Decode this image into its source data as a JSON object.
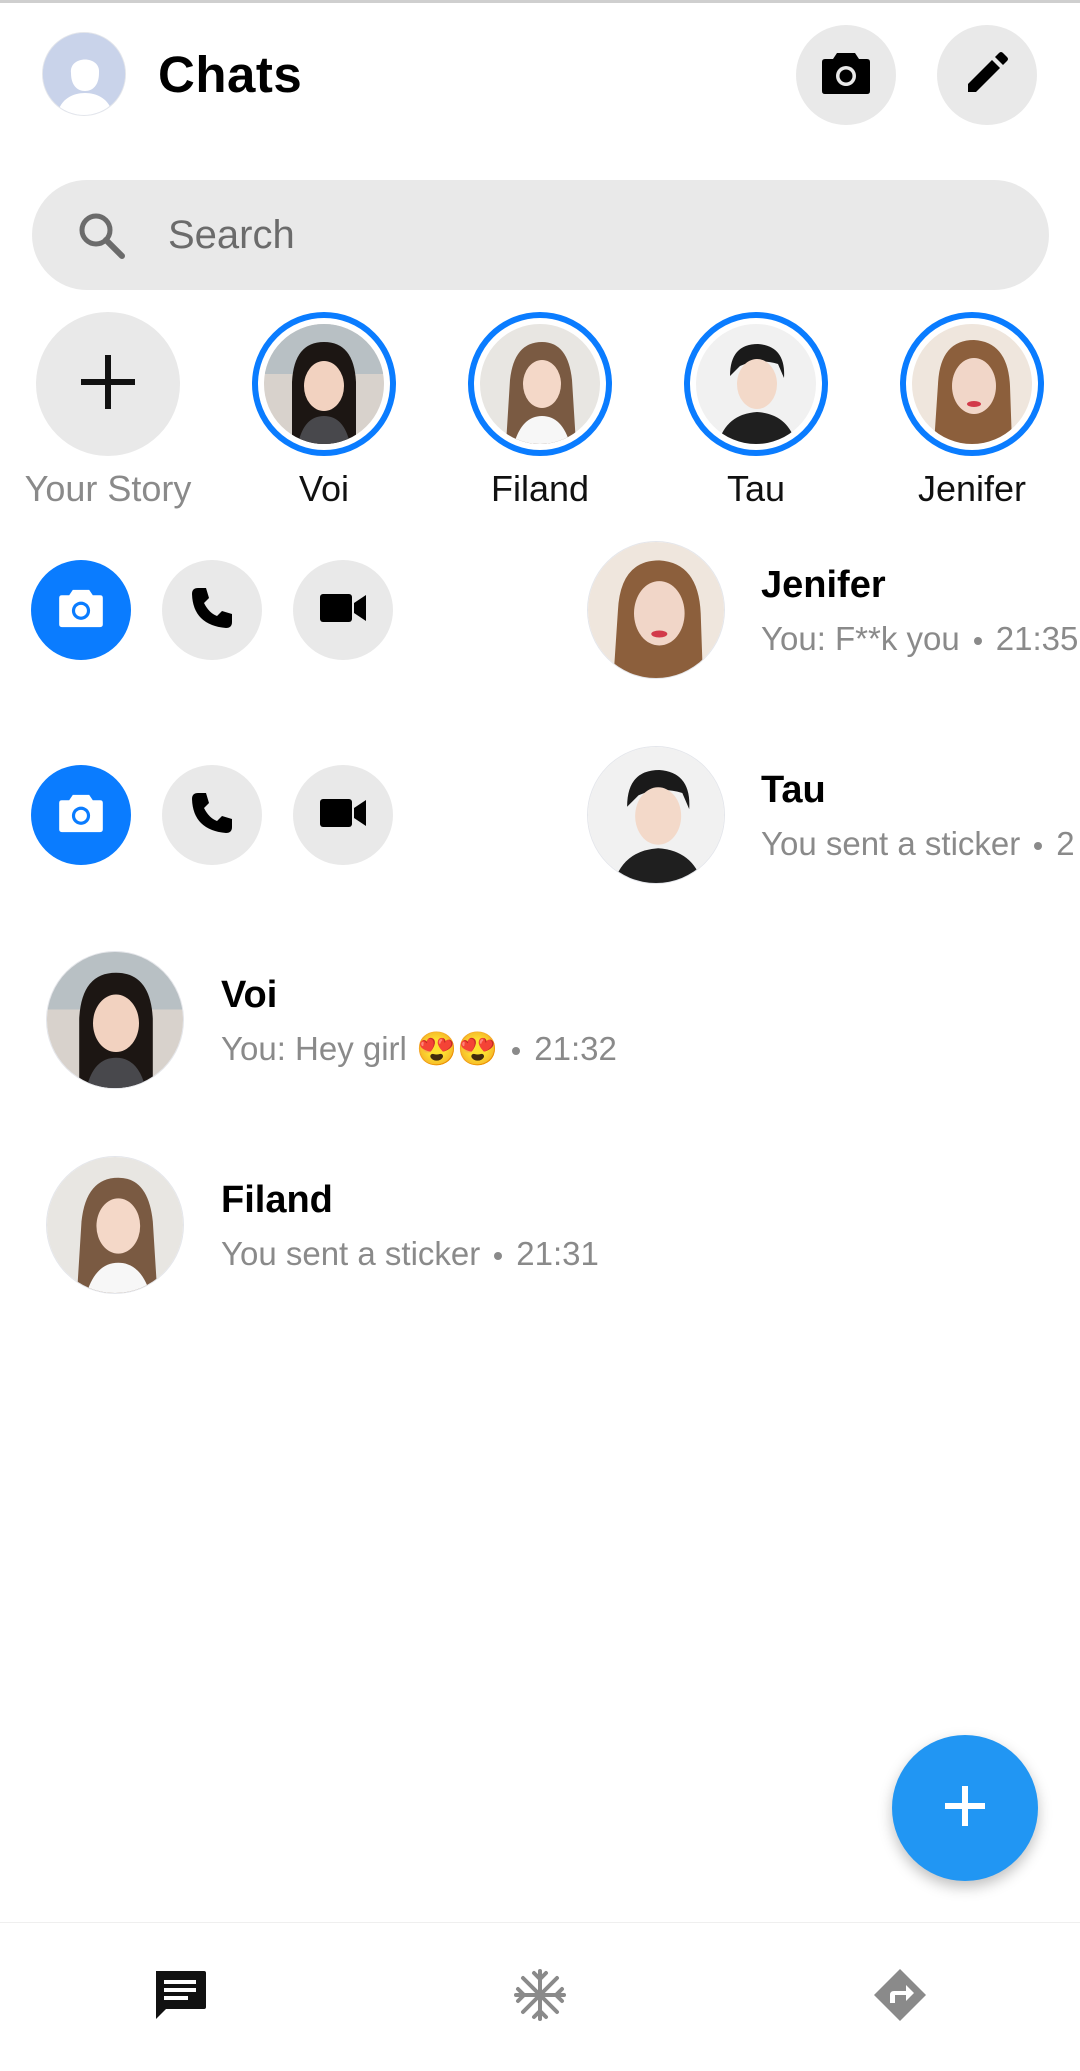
{
  "header": {
    "title": "Chats"
  },
  "search": {
    "placeholder": "Search"
  },
  "stories": [
    {
      "label": "Your Story"
    },
    {
      "label": "Voi"
    },
    {
      "label": "Filand"
    },
    {
      "label": "Tau"
    },
    {
      "label": "Jenifer"
    }
  ],
  "chats": [
    {
      "name": "Jenifer",
      "preview": "You: F**k you",
      "time": "21:35"
    },
    {
      "name": "Tau",
      "preview": "You sent a sticker",
      "time": "2"
    },
    {
      "name": "Voi",
      "preview": "You: Hey girl",
      "emoji": "😍😍",
      "time": "21:32"
    },
    {
      "name": "Filand",
      "preview": "You sent a sticker",
      "time": "21:31"
    }
  ],
  "colors": {
    "accent": "#0a7cff",
    "fab": "#2196f3",
    "chip": "#e9e9e9",
    "muted": "#8a8a8a"
  },
  "icons": [
    "camera-icon",
    "pencil-icon",
    "search-icon",
    "plus-icon",
    "phone-icon",
    "video-icon",
    "chats-icon",
    "people-icon",
    "discover-icon"
  ]
}
